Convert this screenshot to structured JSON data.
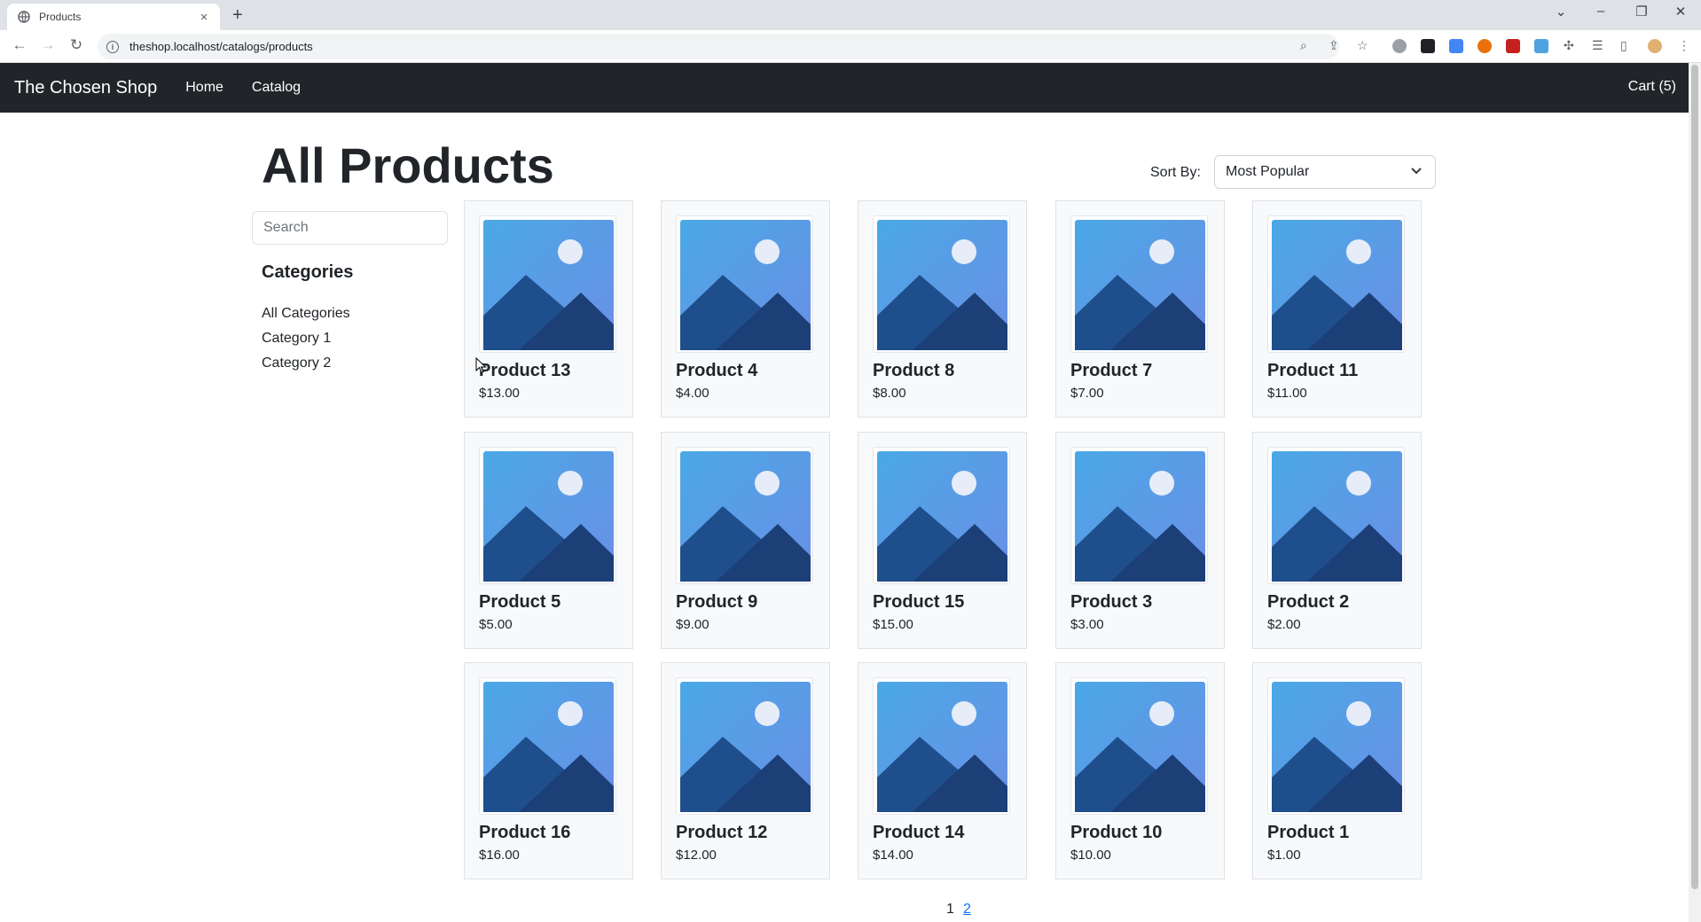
{
  "browser": {
    "tab_title": "Products",
    "tab_close": "×",
    "new_tab": "+",
    "url": "theshop.localhost/catalogs/products"
  },
  "navbar": {
    "brand": "The Chosen Shop",
    "links": [
      "Home",
      "Catalog"
    ],
    "cart": "Cart (5)"
  },
  "main": {
    "title": "All Products",
    "sort_label": "Sort By:",
    "sort_value": "Most Popular",
    "search_placeholder": "Search",
    "categories_title": "Categories",
    "categories": [
      "All Categories",
      "Category 1",
      "Category 2"
    ]
  },
  "products": [
    {
      "name": "Product 13",
      "price": "$13.00"
    },
    {
      "name": "Product 4",
      "price": "$4.00"
    },
    {
      "name": "Product 8",
      "price": "$8.00"
    },
    {
      "name": "Product 7",
      "price": "$7.00"
    },
    {
      "name": "Product 11",
      "price": "$11.00"
    },
    {
      "name": "Product 5",
      "price": "$5.00"
    },
    {
      "name": "Product 9",
      "price": "$9.00"
    },
    {
      "name": "Product 15",
      "price": "$15.00"
    },
    {
      "name": "Product 3",
      "price": "$3.00"
    },
    {
      "name": "Product 2",
      "price": "$2.00"
    },
    {
      "name": "Product 16",
      "price": "$16.00"
    },
    {
      "name": "Product 12",
      "price": "$12.00"
    },
    {
      "name": "Product 14",
      "price": "$14.00"
    },
    {
      "name": "Product 10",
      "price": "$10.00"
    },
    {
      "name": "Product 1",
      "price": "$1.00"
    }
  ],
  "pagination": {
    "current": "1",
    "next": "2"
  },
  "colors": {
    "navbar_bg": "#212529",
    "link": "#0d6efd",
    "card_bg": "#f8f9fa"
  }
}
